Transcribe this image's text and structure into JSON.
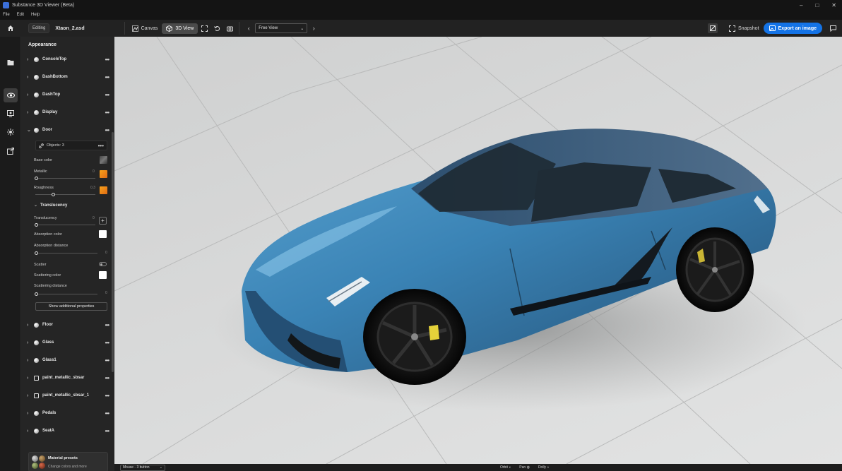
{
  "window": {
    "title": "Substance 3D Viewer (Beta)",
    "controls": [
      "–",
      "□",
      "✕"
    ]
  },
  "menu": [
    "File",
    "Edit",
    "Help"
  ],
  "toolbar": {
    "editing_label": "Editing",
    "filename": "Xtaon_2.asd",
    "canvas_label": "Canvas",
    "view3d_label": "3D View",
    "view_select": "Free View",
    "snapshot_label": "Snapshot",
    "export_label": "Export an image"
  },
  "panel": {
    "title": "Appearance",
    "materials_top": [
      {
        "label": "ConsoleTop",
        "icon": "sphere"
      },
      {
        "label": "DashBottom",
        "icon": "sphere"
      },
      {
        "label": "DashTop",
        "icon": "sphere"
      },
      {
        "label": "Display",
        "icon": "sphere"
      },
      {
        "label": "Door",
        "icon": "sphere",
        "expanded": true
      }
    ],
    "door": {
      "objects_label": "Objects: 3",
      "base_color_label": "Base color",
      "metallic_label": "Metallic",
      "metallic_value": "0",
      "roughness_label": "Roughness",
      "roughness_value": "0.3",
      "translucency_section": "Translucency",
      "translucency_label": "Translucency",
      "translucency_value": "0",
      "absorption_color_label": "Absorption color",
      "absorption_distance_label": "Absorption distance",
      "absorption_distance_value": "0",
      "scatter_label": "Scatter",
      "scattering_color_label": "Scattering color",
      "scattering_distance_label": "Scattering distance",
      "scattering_distance_value": "0",
      "show_more_label": "Show additional properties"
    },
    "materials_bottom": [
      {
        "label": "Floor",
        "icon": "sphere"
      },
      {
        "label": "Glass",
        "icon": "sphere"
      },
      {
        "label": "Glass1",
        "icon": "sphere"
      },
      {
        "label": "paint_metallic_sbsar",
        "icon": "square"
      },
      {
        "label": "paint_metallic_sbsar_1",
        "icon": "square"
      },
      {
        "label": "Pedals",
        "icon": "sphere"
      },
      {
        "label": "SeatA",
        "icon": "sphere"
      }
    ],
    "presets": {
      "title": "Material presets",
      "subtitle": "Change colors and more"
    }
  },
  "bottombar": {
    "mouse_select": "Mouse - 3 button",
    "orbit": "Orbit",
    "pan": "Pan",
    "dolly": "Dolly"
  },
  "colors": {
    "accent": "#1473e6",
    "car_body": "#3a83b5",
    "floor": "#d8d9d9"
  }
}
